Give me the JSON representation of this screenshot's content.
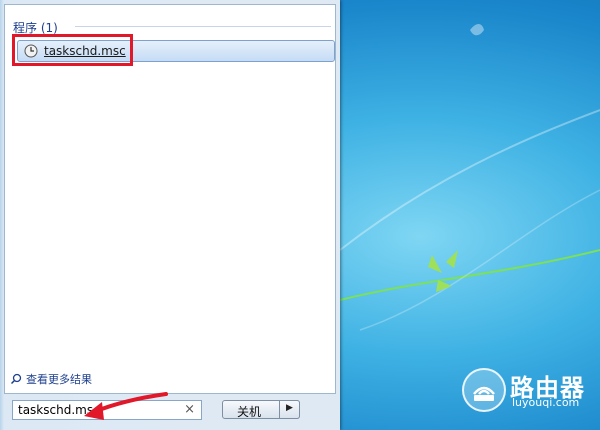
{
  "start_menu": {
    "group_header": "程序 (1)",
    "result_item": {
      "label": "taskschd.msc",
      "icon": "clock-icon"
    },
    "more_results": "查看更多结果",
    "search": {
      "value": "taskschd.msc",
      "clear_label": "×"
    },
    "shutdown": {
      "label": "关机",
      "arrow": "▶"
    }
  },
  "watermark": {
    "title": "路由器",
    "url": "luyouqi.com"
  },
  "colors": {
    "highlight": "#e0182a",
    "header_text": "#1e3f8f"
  }
}
